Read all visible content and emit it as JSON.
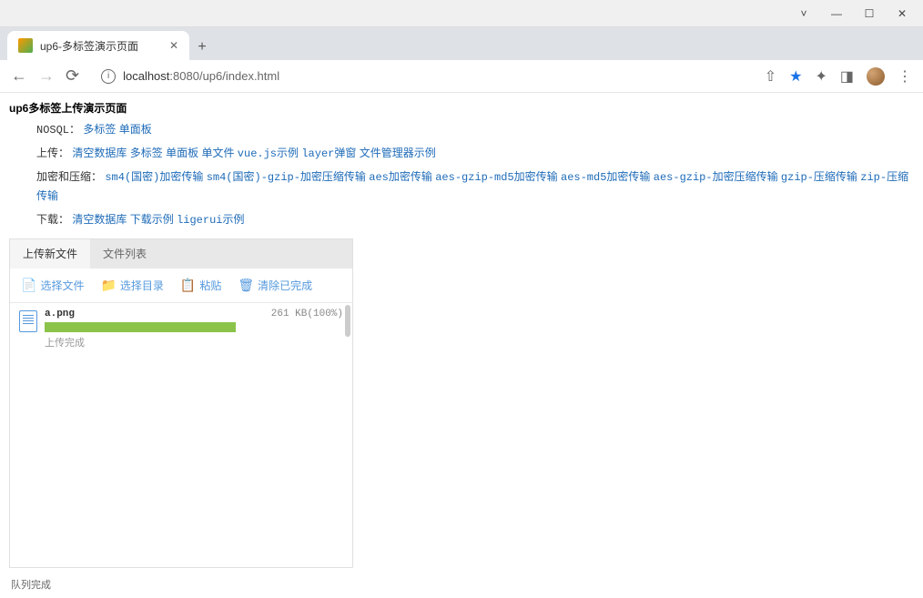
{
  "window": {
    "tab_title": "up6-多标签演示页面"
  },
  "url": {
    "host": "localhost",
    "port": ":8080",
    "path": "/up6/index.html"
  },
  "page": {
    "title": "up6多标签上传演示页面"
  },
  "rows": {
    "nosql": {
      "label": "NOSQL：",
      "links": [
        "多标签",
        "单面板"
      ]
    },
    "upload": {
      "label": "上传：",
      "links": [
        "清空数据库",
        "多标签",
        "单面板",
        "单文件",
        "vue.js示例",
        "layer弹窗",
        "文件管理器示例"
      ]
    },
    "encrypt": {
      "label": "加密和压缩：",
      "links": [
        "sm4(国密)加密传输",
        "sm4(国密)-gzip-加密压缩传输",
        "aes加密传输",
        "aes-gzip-md5加密传输",
        "aes-md5加密传输",
        "aes-gzip-加密压缩传输",
        "gzip-压缩传输",
        "zip-压缩传输"
      ]
    },
    "download": {
      "label": "下载：",
      "links": [
        "清空数据库",
        "下载示例",
        "ligerui示例"
      ]
    }
  },
  "panel": {
    "tabs": [
      "上传新文件",
      "文件列表"
    ],
    "actions": {
      "select_file": "选择文件",
      "select_folder": "选择目录",
      "paste": "粘贴",
      "clear_done": "清除已完成"
    },
    "file": {
      "name": "a.png",
      "size": "261 KB(100%)",
      "status": "上传完成"
    },
    "queue_status": "队列完成"
  }
}
